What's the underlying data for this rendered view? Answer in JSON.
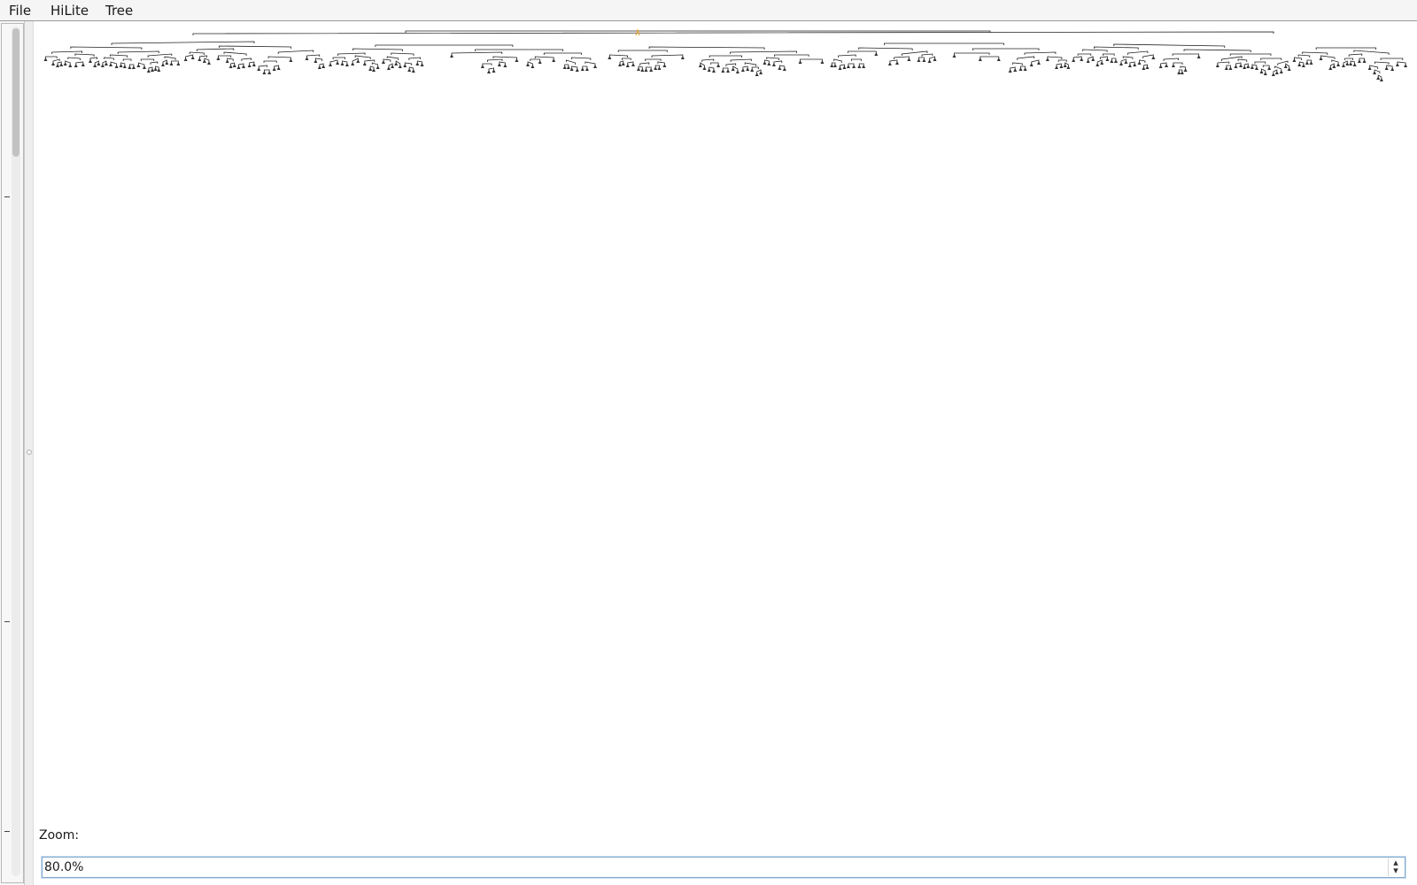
{
  "menubar": {
    "items": [
      {
        "label": "File"
      },
      {
        "label": "HiLite"
      },
      {
        "label": "Tree"
      }
    ]
  },
  "tree_view": {
    "node_color": "#333333",
    "edge_color": "#222222",
    "highlight_color": "#e8a23a"
  },
  "zoom": {
    "label": "Zoom:",
    "value": "80.0%"
  },
  "icons": {
    "spin_up": "▴",
    "spin_down": "▾"
  }
}
